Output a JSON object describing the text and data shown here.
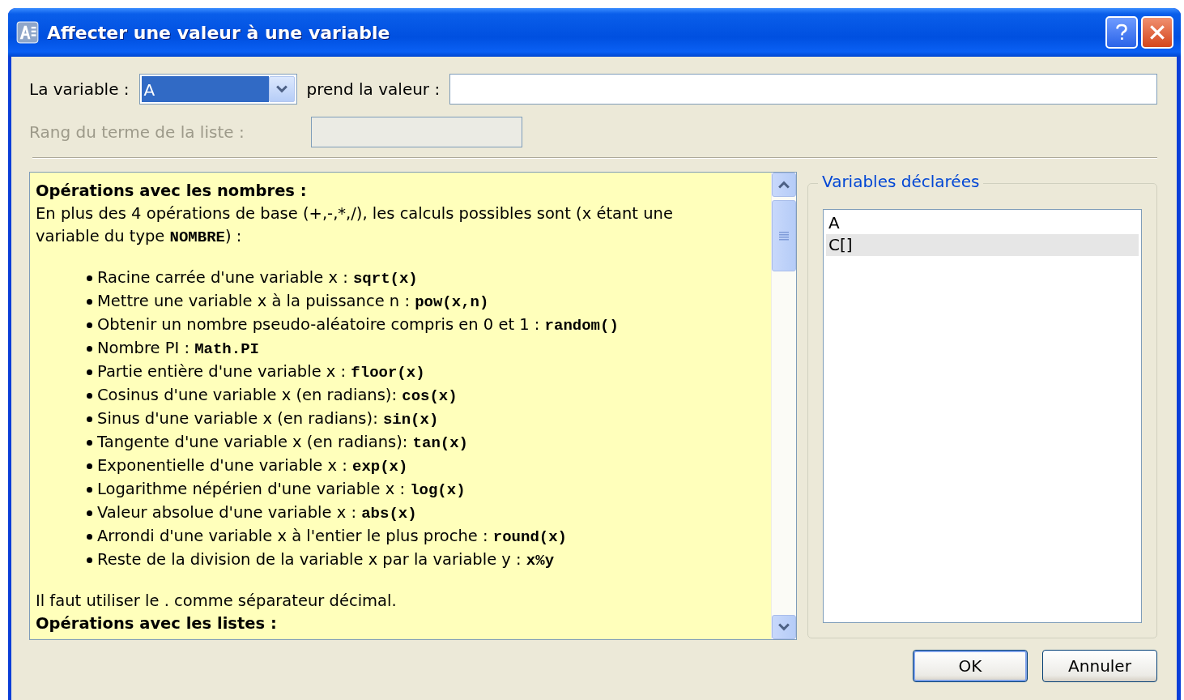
{
  "window": {
    "title": "Affecter une valeur à une variable"
  },
  "variable_row": {
    "label": "La variable :",
    "combo_value": "A",
    "value_label": "prend la valeur :"
  },
  "rank_row": {
    "label": "Rang du terme de la liste :",
    "disabled": true
  },
  "help": {
    "heading": "Opérations avec les nombres :",
    "intro": {
      "before": "En plus des 4 opérations de base (+,-,*,/), les calculs possibles sont (x étant une variable du type ",
      "code": "NOMBRE",
      "after": ") :"
    },
    "items": [
      {
        "text": "Racine carrée d'une variable x : ",
        "code": "sqrt(x)"
      },
      {
        "text": "Mettre une variable x à la puissance n : ",
        "code": "pow(x,n)"
      },
      {
        "text": "Obtenir un nombre pseudo-aléatoire compris en 0 et 1 : ",
        "code": "random()"
      },
      {
        "text": "Nombre PI : ",
        "code": "Math.PI"
      },
      {
        "text": "Partie entière d'une variable x : ",
        "code": "floor(x)"
      },
      {
        "text": "Cosinus d'une variable x (en radians): ",
        "code": "cos(x)"
      },
      {
        "text": "Sinus d'une variable x (en radians): ",
        "code": "sin(x)"
      },
      {
        "text": "Tangente d'une variable x (en radians): ",
        "code": "tan(x)"
      },
      {
        "text": "Exponentielle d'une variable x : ",
        "code": "exp(x)"
      },
      {
        "text": "Logarithme népérien d'une variable x : ",
        "code": "log(x)"
      },
      {
        "text": "Valeur absolue d'une variable x : ",
        "code": "abs(x)"
      },
      {
        "text": "Arrondi d'une variable x à l'entier le plus proche : ",
        "code": "round(x)"
      },
      {
        "text": "Reste de la division de la variable x par la variable y : ",
        "code": "x%y"
      }
    ],
    "note": "Il faut utiliser le . comme séparateur décimal.",
    "heading_2": "Opérations avec les listes :"
  },
  "declared": {
    "legend": "Variables déclarées",
    "items": [
      {
        "label": "A",
        "selected": false
      },
      {
        "label": "C[]",
        "selected": true
      }
    ]
  },
  "buttons": [
    {
      "label": "OK",
      "default": true
    },
    {
      "label": "Annuler",
      "default": false
    }
  ]
}
